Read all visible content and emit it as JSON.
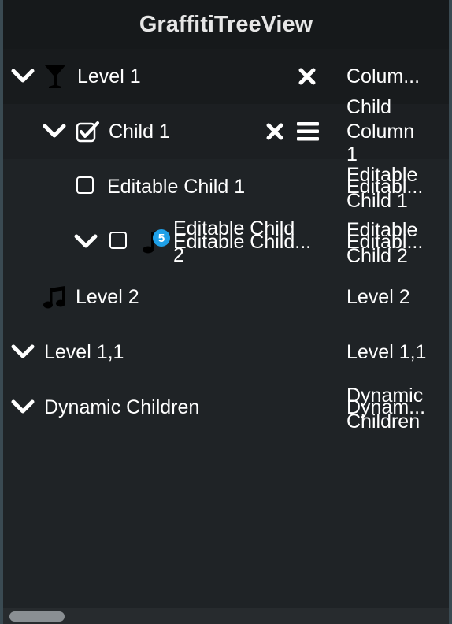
{
  "window": {
    "title": "GraffitiTreeView"
  },
  "rows": [
    {
      "label": "Level 1",
      "column": "Colum..."
    },
    {
      "label": "Child 1",
      "column_a": "Child",
      "column_b": "Column",
      "column_c": "1"
    },
    {
      "label": "Editable Child 1",
      "column_a": "Editable",
      "column_b": "Editabl...",
      "column_c": "Child 1"
    },
    {
      "label_a": "Editable Child",
      "label_b": "Editable Child...",
      "label_c": "2",
      "badge": "5",
      "column_a": "Editable",
      "column_b": "Editabl...",
      "column_c": "Child 2"
    },
    {
      "label": "Level 2",
      "column": "Level 2"
    },
    {
      "label": "Level 1,1",
      "column": "Level 1,1"
    },
    {
      "label": "Dynamic Children",
      "column_a": "Dynamic",
      "column_b": "Dynam...",
      "column_c": "Children"
    }
  ],
  "colors": {
    "background": "#1f2326",
    "titlebar": "#16191b",
    "badge": "#1ea0e8",
    "text": "#ffffff"
  },
  "icons": [
    "chevron-down-icon",
    "cocktail-icon",
    "close-icon",
    "checkbox-checked-icon",
    "menu-icon",
    "checkbox-icon",
    "music-note-icon"
  ]
}
